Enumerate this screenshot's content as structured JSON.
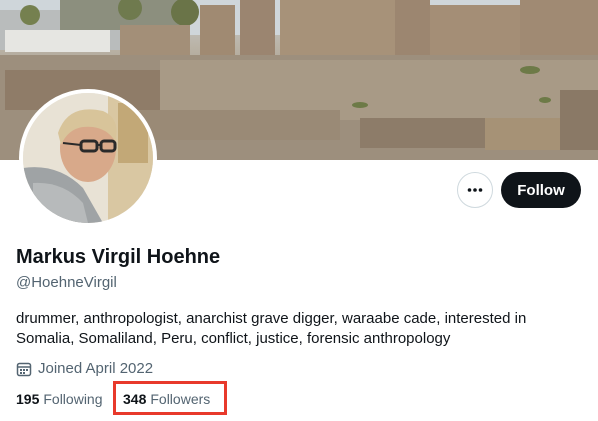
{
  "profile": {
    "display_name": "Markus Virgil Hoehne",
    "handle": "@HoehneVirgil",
    "bio_lines": [
      "drummer, anthropologist, anarchist grave digger, waraabe cade, interested in",
      "Somalia, Somaliland, Peru, conflict, justice, forensic anthropology"
    ],
    "joined": "Joined April 2022"
  },
  "actions": {
    "follow_label": "Follow",
    "more_icon": "more-horizontal-icon"
  },
  "stats": {
    "following_count": "195",
    "following_label": "Following",
    "followers_count": "348",
    "followers_label": "Followers"
  },
  "colors": {
    "primary_text": "#0f1419",
    "secondary_text": "#536471",
    "follow_button_bg": "#0f1419",
    "highlight": "#e8392b"
  }
}
